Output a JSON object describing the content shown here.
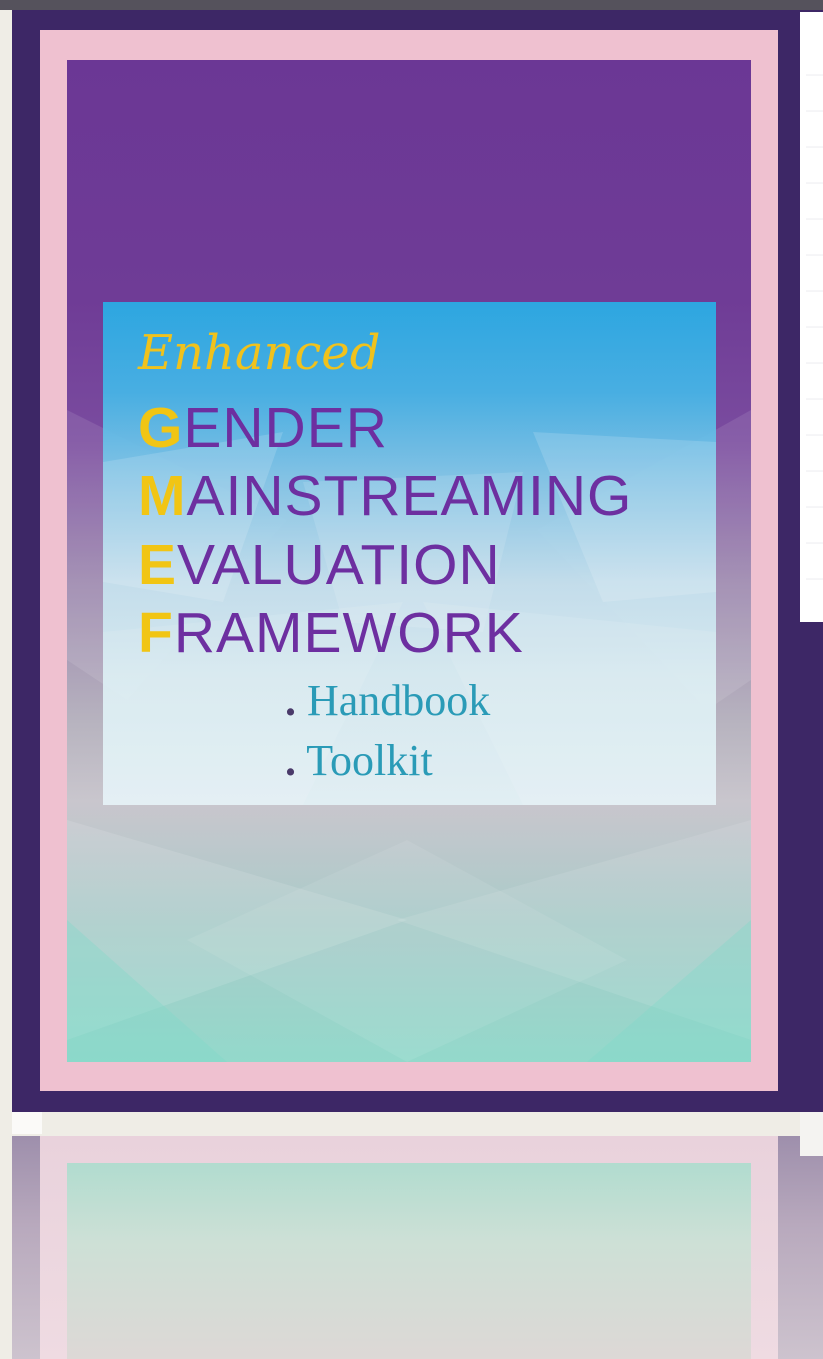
{
  "book": {
    "title_prefix": "Enhanced",
    "title_words": [
      {
        "initial": "G",
        "rest": "ENDER"
      },
      {
        "initial": "M",
        "rest": "AINSTREAMING"
      },
      {
        "initial": "E",
        "rest": "VALUATION"
      },
      {
        "initial": "F",
        "rest": "RAMEWORK"
      }
    ],
    "sections": [
      {
        "bullet": ".",
        "label": "Handbook"
      },
      {
        "bullet": ".",
        "label": "Toolkit"
      }
    ]
  },
  "colors": {
    "cover_purple": "#6e3d94",
    "frame_pink": "#efc1d0",
    "back_cover": "#3d2766",
    "panel_blue": "#28aee6",
    "title_purple": "#6d2fa0",
    "accent_yellow": "#f1c514",
    "subtitle_teal": "#2a9bb7"
  }
}
